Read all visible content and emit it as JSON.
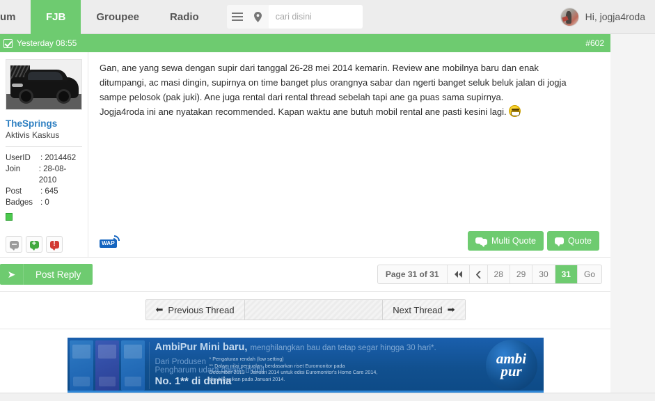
{
  "navbar": {
    "items": [
      {
        "label": "um",
        "active": false,
        "partial": true
      },
      {
        "label": "FJB",
        "active": true,
        "partial": false
      },
      {
        "label": "Groupee",
        "active": false,
        "partial": false
      },
      {
        "label": "Radio",
        "active": false,
        "partial": false
      }
    ],
    "menu_icon": "hamburger-icon",
    "location_icon": "location-pin-icon",
    "search": {
      "placeholder": "cari disini",
      "value": "",
      "icon": "search-icon"
    },
    "user": {
      "greeting": "Hi, jogja4roda",
      "avatar": "user-avatar"
    }
  },
  "post": {
    "meta": {
      "timestamp": "Yesterday 08:55",
      "post_number": "#602",
      "checkbox_icon": "checkbox-checked-icon"
    },
    "author": {
      "username": "TheSprings",
      "title": "Aktivis Kaskus",
      "avatar_alt": "black-suv-car-photo",
      "stats": [
        {
          "label": "UserID",
          "separator": ":",
          "value": "2014462",
          "is_link": false
        },
        {
          "label": "Join",
          "separator": ":",
          "value": "28-08-2010",
          "is_link": false
        },
        {
          "label": "Post",
          "separator": ":",
          "value": "645",
          "is_link": false
        },
        {
          "label": "Badges",
          "separator": ":",
          "value": "0",
          "is_link": true
        }
      ],
      "online_status": "online",
      "action_buttons": [
        {
          "name": "profile-bubble-button",
          "style": "gray"
        },
        {
          "name": "give-reputation-button",
          "style": "green"
        },
        {
          "name": "report-post-button",
          "style": "red"
        }
      ]
    },
    "content": {
      "paragraph1": "Gan, ane yang sewa dengan supir dari tanggal 26-28 mei 2014 kemarin. Review ane mobilnya baru dan enak ditumpangi, ac masi dingin, supirnya on time banget plus orangnya sabar dan ngerti banget seluk beluk jalan di jogja sampe pelosok (pak juki). Ane juga rental dari rental thread sebelah tapi ane ga puas sama supirnya.",
      "paragraph2": "Jogja4roda ini ane nyatakan recommended. Kapan waktu ane butuh mobil rental ane pasti kesini lagi.",
      "emoticon": "grinning-face-emoticon"
    },
    "footer": {
      "wap_label": "WAP",
      "multi_quote_label": "Multi Quote",
      "quote_label": "Quote"
    }
  },
  "reply_bar": {
    "post_reply_label": "Post Reply",
    "post_reply_icon": "reply-arrow-icon",
    "pagination": {
      "page_label": "Page 31 of 31",
      "first_icon": "double-chevron-left-icon",
      "prev_icon": "chevron-left-icon",
      "pages": [
        "28",
        "29",
        "30",
        "31"
      ],
      "active_page": "31",
      "go_label": "Go"
    }
  },
  "thread_nav": {
    "previous_label": "Previous Thread",
    "previous_icon": "arrow-left-icon",
    "next_label": "Next Thread",
    "next_icon": "arrow-right-icon"
  },
  "ad": {
    "headline": "AmbiPur Mini baru,",
    "headline_sub": "menghilangkan bau dan tetap segar hingga 30 hari*.",
    "line1": "Dari Produsen",
    "line2": "Pengharum udara dalam mobil",
    "line3": "No. 1** di dunia",
    "footnote1": "* Pengaturan rendah (low setting)",
    "footnote2": "** Dalam nilai penjualan, berdasarkan riset Euromonitor pada",
    "footnote3": "December 2013 – Januari 2014 untuk edisi Euromonitor's Home Care 2014,",
    "footnote4": "dipublikasikan pada Januari 2014.",
    "logo_top": "ambi",
    "logo_bottom": "pur"
  },
  "colors": {
    "brand_green": "#6ecb70",
    "link_blue": "#2d7fc1",
    "ad_blue": "#11508f"
  }
}
